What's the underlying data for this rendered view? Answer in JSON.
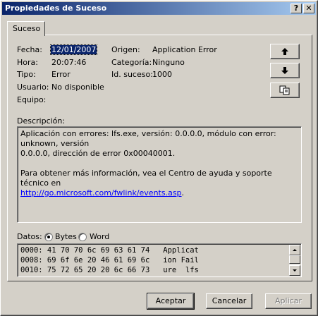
{
  "window": {
    "title": "Propiedades de Suceso",
    "help_btn": "?",
    "close_btn": "✕"
  },
  "tabs": [
    {
      "label": "Suceso"
    }
  ],
  "fields": {
    "fecha_label": "Fecha:",
    "fecha_value": "12/01/2007",
    "hora_label": "Hora:",
    "hora_value": "20:07:46",
    "tipo_label": "Tipo:",
    "tipo_value": "Error",
    "usuario_label": "Usuario:",
    "usuario_value": "No disponible",
    "equipo_label": "Equipo:",
    "equipo_value": "",
    "origen_label": "Origen:",
    "origen_value": "Application Error",
    "categoria_label": "Categoría:",
    "categoria_value": "Ninguno",
    "id_label": "Id. suceso:",
    "id_value": "1000"
  },
  "side_buttons": {
    "up_icon": "arrow-up-icon",
    "down_icon": "arrow-down-icon",
    "copy_icon": "copy-icon"
  },
  "descripcion": {
    "label": "Descripción:",
    "line1": "Aplicación con errores: lfs.exe, versión: 0.0.0.0, módulo con error: unknown, versión",
    "line2": "0.0.0.0, dirección de error 0x00040001.",
    "line3": "Para obtener más información, vea el Centro de ayuda y soporte técnico en",
    "link": "http://go.microsoft.com/fwlink/events.asp",
    "link_suffix": "."
  },
  "datos": {
    "label": "Datos:",
    "bytes_label": "Bytes",
    "word_label": "Word",
    "selected": "Bytes",
    "lines": [
      "0000: 41 70 70 6c 69 63 61 74   Applicat",
      "0008: 69 6f 6e 20 46 61 69 6c   ion Fail",
      "0010: 75 72 65 20 20 6c 66 73   ure  lfs"
    ]
  },
  "buttons": {
    "aceptar": "Aceptar",
    "cancelar": "Cancelar",
    "aplicar": "Aplicar"
  }
}
